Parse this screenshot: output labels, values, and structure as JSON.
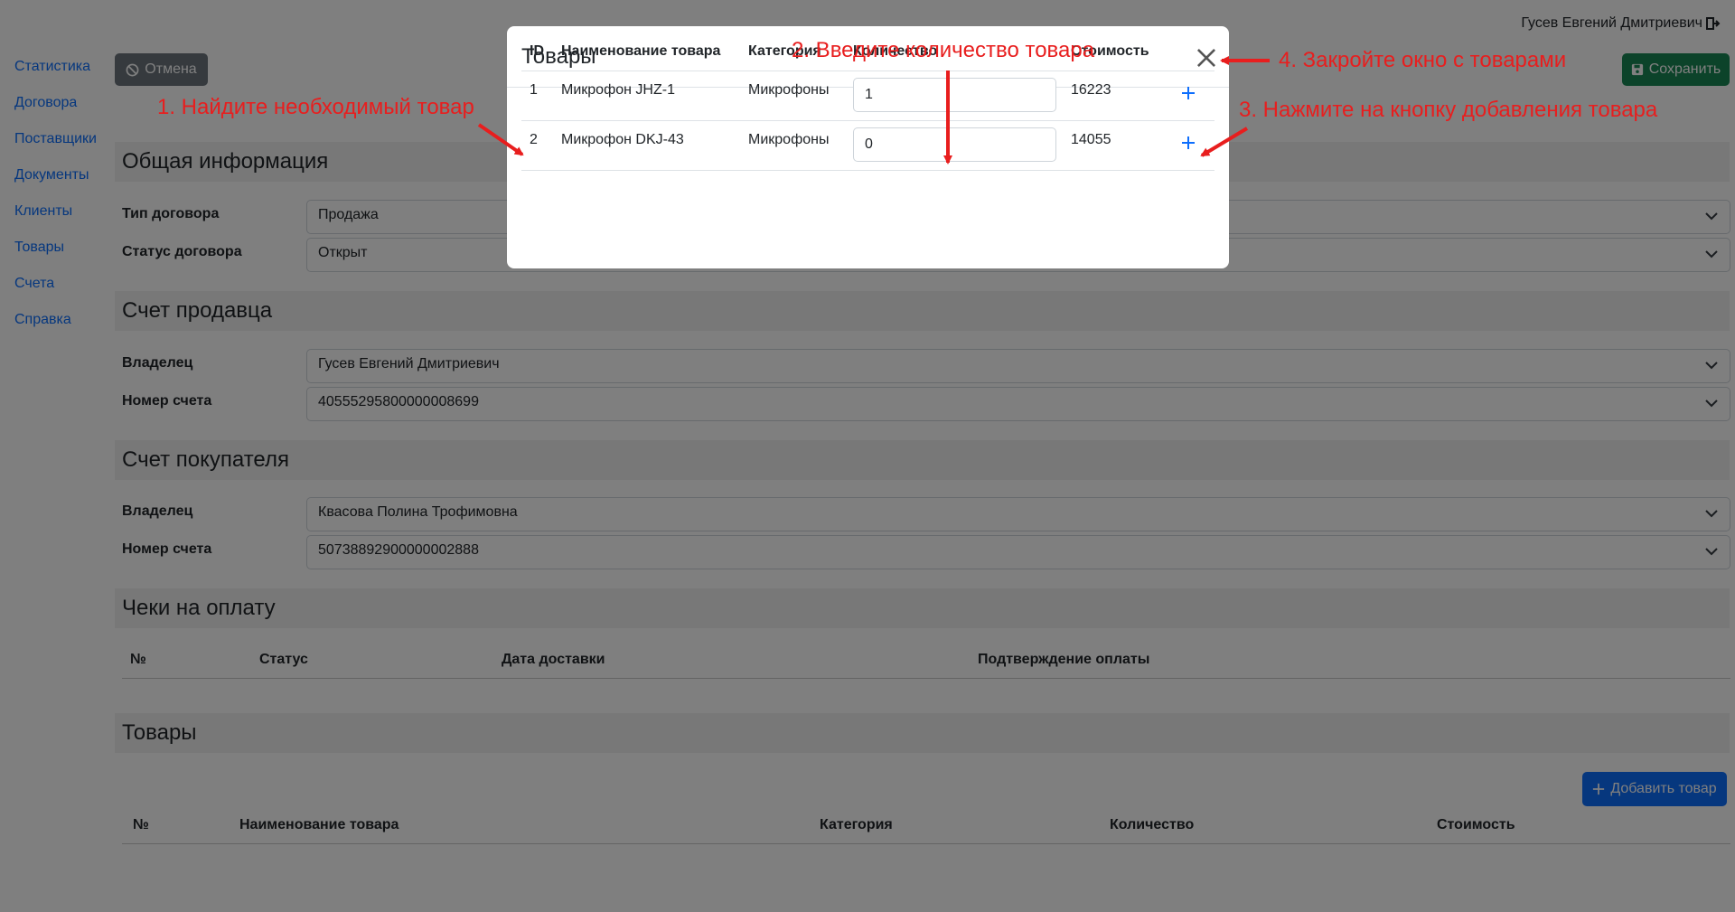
{
  "header": {
    "user_name": "Гусев Евгений Дмитриевич"
  },
  "sidebar": {
    "items": [
      "Статистика",
      "Договора",
      "Поставщики",
      "Документы",
      "Клиенты",
      "Товары",
      "Счета",
      "Справка"
    ]
  },
  "toolbar": {
    "cancel_label": "Отмена",
    "save_label": "Сохранить"
  },
  "general": {
    "title": "Общая информация",
    "type_label": "Тип договора",
    "type_value": "Продажа",
    "status_label": "Статус договора",
    "status_value": "Открыт"
  },
  "seller": {
    "title": "Счет продавца",
    "owner_label": "Владелец",
    "owner_value": "Гусев Евгений Дмитриевич",
    "account_label": "Номер счета",
    "account_value": "40555295800000008699"
  },
  "buyer": {
    "title": "Счет покупателя",
    "owner_label": "Владелец",
    "owner_value": "Квасова Полина Трофимовна",
    "account_label": "Номер счета",
    "account_value": "50738892900000002888"
  },
  "checks": {
    "title": "Чеки на оплату",
    "columns": [
      "№",
      "Статус",
      "Дата доставки",
      "Подтверждение оплаты"
    ]
  },
  "goods": {
    "title": "Товары",
    "add_label": "Добавить товар",
    "columns": [
      "№",
      "Наименование товара",
      "Категория",
      "Количество",
      "Стоимость"
    ]
  },
  "modal": {
    "title": "Товары",
    "columns": [
      "ID",
      "Наименование товара",
      "Категория",
      "Количество",
      "Стоимость"
    ],
    "rows": [
      {
        "id": "1",
        "name": "Микрофон JHZ-1",
        "category": "Микрофоны",
        "qty": "1",
        "price": "16223"
      },
      {
        "id": "2",
        "name": "Микрофон DKJ-43",
        "category": "Микрофоны",
        "qty": "0",
        "price": "14055"
      }
    ]
  },
  "annotations": {
    "step1": "1. Найдите необходимый товар",
    "step2": "2. Введите количество товара",
    "step3": "3. Нажмите на кнопку добавления товара",
    "step4": "4. Закройте окно с товарами",
    "color": "#e81e1e"
  },
  "colors": {
    "primary": "#0d6efd",
    "success": "#198754",
    "secondary": "#6c757d"
  }
}
